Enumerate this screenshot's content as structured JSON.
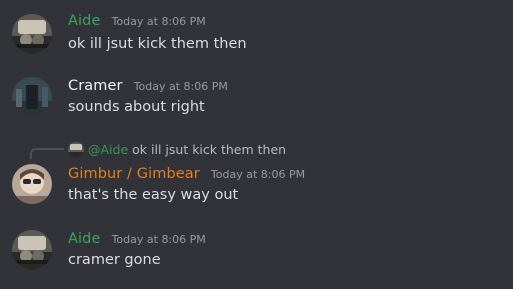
{
  "messages": [
    {
      "author": "Aide",
      "author_color": "#3ba55c",
      "timestamp": "Today at 8:06 PM",
      "content": "ok ill jsut kick them then"
    },
    {
      "author": "Cramer",
      "author_color": "#f2f3f5",
      "timestamp": "Today at 8:06 PM",
      "content": "sounds about right"
    },
    {
      "author": "Gimbur / Gimbear",
      "author_color": "#e67e22",
      "timestamp": "Today at 8:06 PM",
      "content": "that's the easy way out",
      "reply": {
        "mention": "@Aide",
        "mention_color": "#3ba55c",
        "text": "ok ill jsut kick them then"
      }
    },
    {
      "author": "Aide",
      "author_color": "#3ba55c",
      "timestamp": "Today at 8:06 PM",
      "content": "cramer gone"
    }
  ]
}
